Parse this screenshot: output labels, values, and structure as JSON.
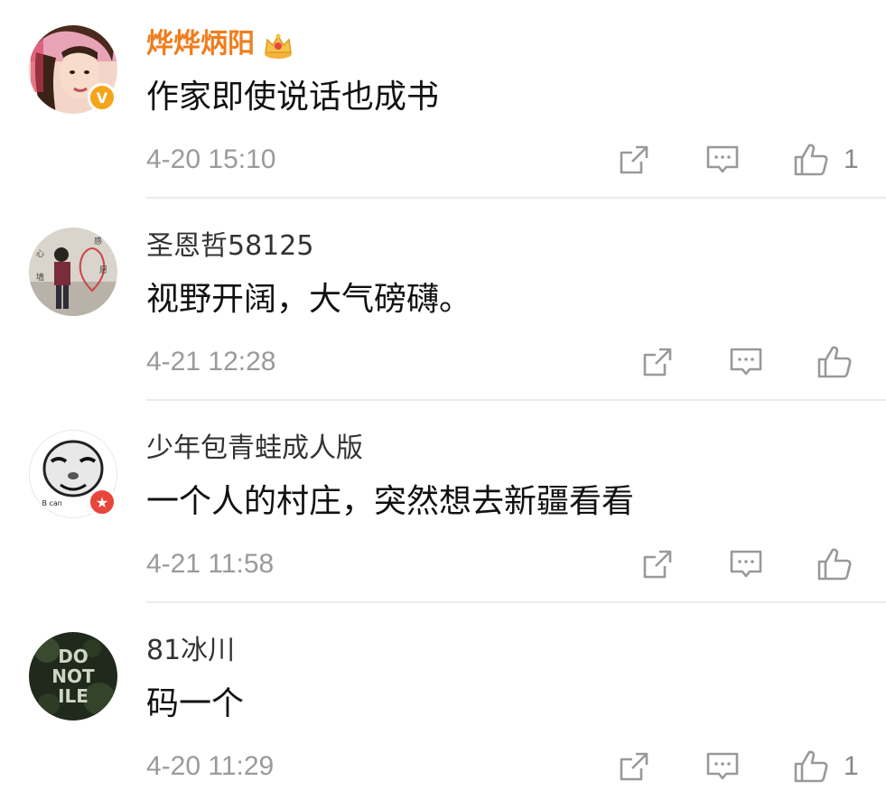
{
  "comments": [
    {
      "username": "烨烨炳阳",
      "vip": true,
      "badge": "V",
      "text": "作家即使说话也成书",
      "time": "4-20 15:10",
      "likes": "1"
    },
    {
      "username": "圣恩哲58125",
      "vip": false,
      "badge": "",
      "text": "视野开阔，大气磅礴。",
      "time": "4-21 12:28",
      "likes": ""
    },
    {
      "username": "少年包青蛙成人版",
      "vip": false,
      "badge": "★",
      "text": "一个人的村庄，突然想去新疆看看",
      "time": "4-21 11:58",
      "likes": ""
    },
    {
      "username": "81冰川",
      "vip": false,
      "badge": "",
      "text": "码一个",
      "time": "4-20 11:29",
      "likes": "1"
    }
  ],
  "icons": {
    "share": "share-icon",
    "comment": "comment-icon",
    "like": "thumbs-up-icon",
    "crown": "crown-icon"
  },
  "colors": {
    "vip_name": "#f07d1e",
    "name": "#333333",
    "text": "#111111",
    "meta": "#9a9a9a",
    "divider": "#ebebeb",
    "verified_badge": "#f6a51b",
    "star_badge": "#e8453c"
  }
}
